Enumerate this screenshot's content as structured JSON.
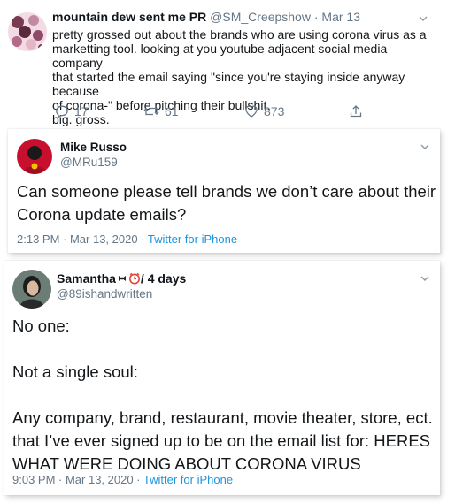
{
  "tweet1": {
    "name": "mountain dew sent me PR",
    "handle": "@SM_Creepshow",
    "sep": "·",
    "date": "Mar 13",
    "lines": [
      "pretty grossed out about the brands who are using corona virus as a",
      "marketting tool. looking at you youtube adjacent social media company",
      "that started the email saying \"since you're staying inside anyway because",
      "of corona-\" before pitching their bullshit.",
      "big. gross."
    ],
    "replies": "17",
    "retweets": "61",
    "likes": "873"
  },
  "tweet2": {
    "name": "Mike Russo",
    "handle": "@MRu159",
    "lines": [
      "Can someone please tell brands we don’t care about their",
      "Corona update emails?"
    ],
    "time_date": "2:13 PM · Mar 13, 2020 · ",
    "source": "Twitter for iPhone"
  },
  "tweet3": {
    "name": "Samantha",
    "name_suffix": " / 4 days",
    "handle": "@89ishandwritten",
    "lines": [
      "No one:",
      "",
      "Not a single soul:",
      "",
      "Any company, brand, restaurant, movie theater, store, ect.",
      "that I’ve ever signed up to be on the email list for: HERES",
      "WHAT WERE DOING ABOUT CORONA VIRUS"
    ],
    "time_date": "9:03 PM · Mar 13, 2020 · ",
    "source": "Twitter for iPhone"
  },
  "colors": {
    "muted": "#657786",
    "link": "#1b95e0",
    "text": "#14171a"
  }
}
